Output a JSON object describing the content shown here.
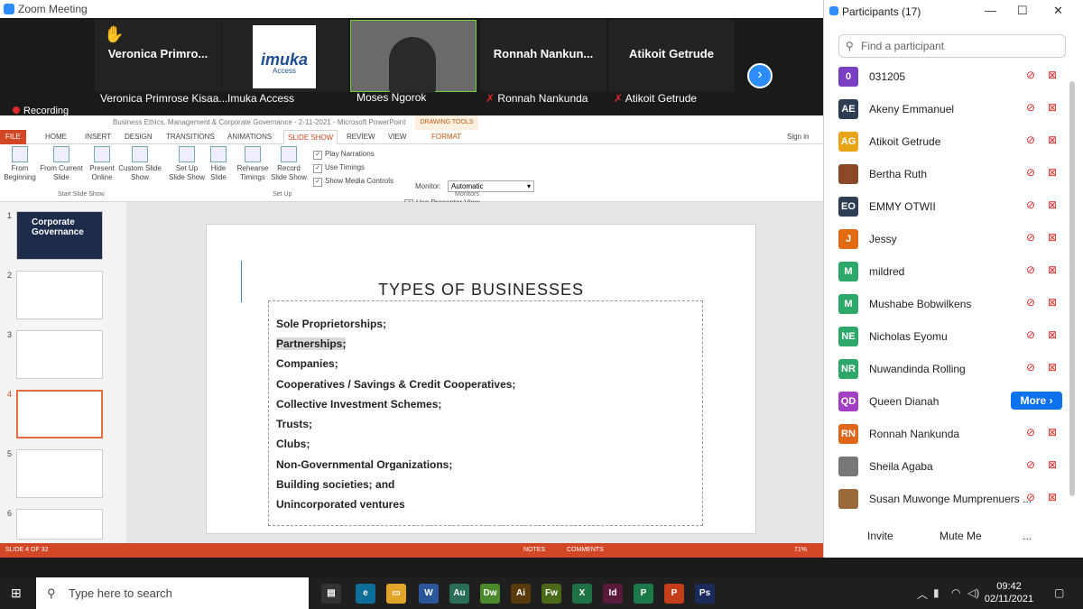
{
  "zoom": {
    "title": "Zoom Meeting",
    "recording": "Recording",
    "tiles": [
      {
        "big": "Veronica  Primro...",
        "cap": "Veronica Primrose Kisaa..."
      },
      {
        "big": "imuka",
        "cap": "Imuka Access",
        "sub": "Access"
      },
      {
        "big": "",
        "cap": "Moses Ngorok"
      },
      {
        "big": "Ronnah  Nankun...",
        "cap": "Ronnah Nankunda"
      },
      {
        "big": "Atikoit  Getrude",
        "cap": "Atikoit Getrude"
      }
    ]
  },
  "ppt": {
    "title": "Business Ethics, Management & Corporate Governance - 2-11-2021 - Microsoft PowerPoint",
    "drawing_tools": "DRAWING TOOLS",
    "tabs": [
      "FILE",
      "HOME",
      "INSERT",
      "DESIGN",
      "TRANSITIONS",
      "ANIMATIONS",
      "SLIDE SHOW",
      "REVIEW",
      "VIEW",
      "FORMAT"
    ],
    "sign_in": "Sign in",
    "ribbon": {
      "from_beginning": "From Beginning",
      "from_current": "From Current Slide",
      "present_online": "Present Online",
      "custom_show": "Custom Slide Show",
      "start_group": "Start Slide Show",
      "setup": "Set Up Slide Show",
      "hide": "Hide Slide",
      "rehearse": "Rehearse Timings",
      "record": "Record Slide Show",
      "play_narrations": "Play Narrations",
      "use_timings": "Use Timings",
      "show_media": "Show Media Controls",
      "setup_group": "Set Up",
      "monitor_label": "Monitor:",
      "monitor_value": "Automatic",
      "use_presenter": "Use Presenter View",
      "monitors_group": "Monitors"
    },
    "thumb_nums": [
      "1",
      "2",
      "3",
      "4",
      "5",
      "6"
    ],
    "thumb1_title": "Corporate Governance",
    "slide_title": "TYPES OF BUSINESSES",
    "items": [
      "Sole Proprietorships;",
      "Partnerships;",
      "Companies;",
      "Cooperatives / Savings & Credit Cooperatives;",
      "Collective Investment Schemes;",
      "Trusts;",
      "Clubs;",
      "Non-Governmental Organizations;",
      "Building societies; and",
      "Unincorporated ventures"
    ],
    "status": {
      "slide": "SLIDE 4 OF 32",
      "notes": "NOTES",
      "comments": "COMMENTS",
      "zoom": "71%"
    }
  },
  "participants": {
    "title": "Participants (17)",
    "search_placeholder": "Find a participant",
    "more": "More",
    "list": [
      {
        "init": "0",
        "name": "031205",
        "color": "#7b3fc4"
      },
      {
        "init": "AE",
        "name": "Akeny Emmanuel",
        "color": "#2e3e52"
      },
      {
        "init": "AG",
        "name": "Atikoit Getrude",
        "color": "#e8a317"
      },
      {
        "init": "",
        "name": "Bertha Ruth",
        "color": "#8a4a2a"
      },
      {
        "init": "EO",
        "name": "EMMY OTWII",
        "color": "#2e3e52"
      },
      {
        "init": "J",
        "name": "Jessy",
        "color": "#e06b12"
      },
      {
        "init": "M",
        "name": "mildred",
        "color": "#2ea86a"
      },
      {
        "init": "M",
        "name": "Mushabe Bobwilkens",
        "color": "#2ea86a"
      },
      {
        "init": "NE",
        "name": "Nicholas Eyomu",
        "color": "#2ea86a"
      },
      {
        "init": "NR",
        "name": "Nuwandinda Rolling",
        "color": "#2ea86a"
      },
      {
        "init": "QD",
        "name": "Queen Dianah",
        "color": "#a23fc4"
      },
      {
        "init": "RN",
        "name": "Ronnah Nankunda",
        "color": "#e0661a"
      },
      {
        "init": "",
        "name": "Sheila Agaba",
        "color": "#777777"
      },
      {
        "init": "",
        "name": "Susan Muwonge Mumprenuers ...",
        "color": "#9a6a3a"
      }
    ],
    "invite": "Invite",
    "mute": "Mute Me",
    "dots": "..."
  },
  "taskbar": {
    "search": "Type here to search",
    "time": "09:42",
    "date": "02/11/2021",
    "apps": [
      {
        "t": "Au",
        "c": "#2a6e5a"
      },
      {
        "t": "Dw",
        "c": "#4a8a2a"
      },
      {
        "t": "Ai",
        "c": "#5a3a0a"
      },
      {
        "t": "Fw",
        "c": "#4a6a1a"
      },
      {
        "t": "X",
        "c": "#1e7145"
      },
      {
        "t": "Id",
        "c": "#5a1a3a"
      },
      {
        "t": "P",
        "c": "#1a7a4a"
      },
      {
        "t": "P",
        "c": "#c43e1c"
      },
      {
        "t": "Ps",
        "c": "#1a2a5a"
      }
    ]
  }
}
